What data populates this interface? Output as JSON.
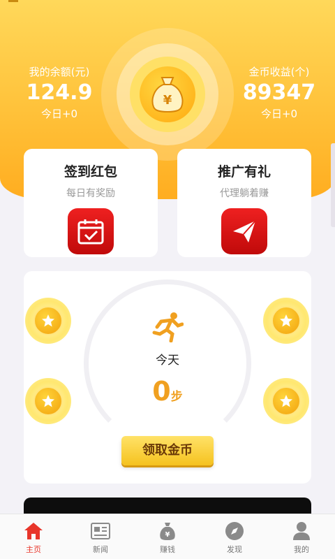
{
  "header": {
    "balance": {
      "label": "我的余额(元)",
      "value": "124.9",
      "today": "今日+0"
    },
    "coins": {
      "label": "金币收益(个)",
      "value": "89347",
      "today": "今日+0"
    }
  },
  "promos": [
    {
      "title": "签到红包",
      "desc": "每日有奖励",
      "icon": "calendar-check-icon"
    },
    {
      "title": "推广有礼",
      "desc": "代理躺着赚",
      "icon": "paper-plane-icon"
    }
  ],
  "steps": {
    "today_label": "今天",
    "count": "0",
    "unit": "步",
    "claim_label": "领取金币"
  },
  "tabs": [
    {
      "label": "主页",
      "icon": "home-icon",
      "active": true
    },
    {
      "label": "新闻",
      "icon": "news-icon"
    },
    {
      "label": "赚钱",
      "icon": "money-bag-icon"
    },
    {
      "label": "发现",
      "icon": "compass-icon"
    },
    {
      "label": "我的",
      "icon": "user-icon"
    }
  ],
  "colors": {
    "accent": "#ffc23a",
    "active_tab": "#e8352a",
    "promo_icon": "#e01818",
    "steps": "#f0a020"
  }
}
